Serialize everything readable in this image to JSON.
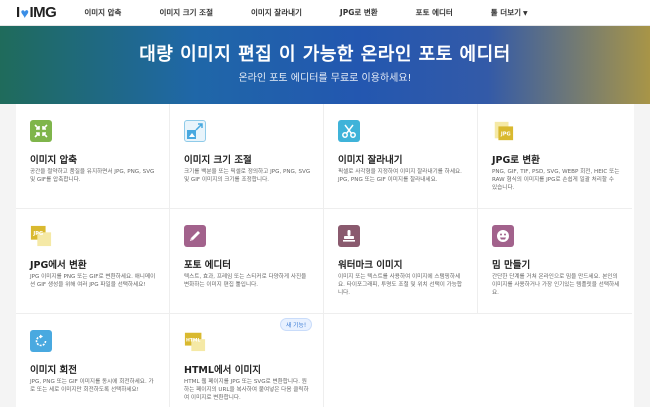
{
  "header": {
    "logo_left": "I",
    "logo_right": "IMG",
    "nav": [
      {
        "label": "이미지 압축"
      },
      {
        "label": "이미지 크기 조절"
      },
      {
        "label": "이미지 잘라내기"
      },
      {
        "label": "JPG로 변환"
      },
      {
        "label": "포토 에디터"
      },
      {
        "label": "툴 더보기"
      }
    ]
  },
  "hero": {
    "title": "대량 이미지 편집 이 가능한 온라인 포토 에디터",
    "subtitle": "온라인 포토 에디터를 무료로 이용하세요!"
  },
  "tools": [
    {
      "title": "이미지 압축",
      "desc": "공간을 절약하고 품질을 유지하면서 JPG, PNG, SVG 및 GIF를 압축합니다.",
      "icon": "compress-arrows-icon",
      "color": "#7fb54b"
    },
    {
      "title": "이미지 크기 조절",
      "desc": "크기를 백분율 또는 픽셀로 정의하고 JPG, PNG, SVG 및 GIF 이미지의 크기를 조정합니다.",
      "icon": "resize-image-icon",
      "color": "#49a9e0"
    },
    {
      "title": "이미지 잘라내기",
      "desc": "픽셀로 사각형을 지정하여 이미지 잘라내기를 하세요. JPG, PNG 또는 GIF 이미지를 잘라내세요.",
      "icon": "scissors-icon",
      "color": "#3fb3d9"
    },
    {
      "title": "JPG로 변환",
      "desc": "PNG, GIF, TIF, PSD, SVG, WEBP 회전, HEIC 또는 RAW 형식의 이미지를 JPG로 손쉽게 일괄 처리할 수 있습니다.",
      "icon": "jpg-file-icon",
      "color": "#d9b92f",
      "badge_text": "JPG"
    },
    {
      "title": "JPG에서 변환",
      "desc": "JPG 이미지를 PNG 또는 GIF로 변환하세요. 애니메이션 GIF 생성을 위해 여러 JPG 파일을 선택하세요!",
      "icon": "jpg-convert-icon",
      "color": "#d9b92f",
      "badge_text": "JPG"
    },
    {
      "title": "포토 에디터",
      "desc": "텍스트, 효과, 프레임 또는 스티커로 다양하게 사진을 변화하는 이미지 편집 툴입니다.",
      "icon": "pencil-icon",
      "color": "#a2628c"
    },
    {
      "title": "워터마크 이미지",
      "desc": "이미지 또는 텍스트를 사용하여 이미지에 스탬핑하세요. 타이포그래피, 투명도 조절 및 위치 선택이 가능합니다.",
      "icon": "stamp-icon",
      "color": "#8a5a6e"
    },
    {
      "title": "밈 만들기",
      "desc": "간단한 단계를 거쳐 온라인으로 밈을 만드세요. 본인의 이미지를 사용하거나 가장 인기있는 템플릿을 선택하세요.",
      "icon": "meme-face-icon",
      "color": "#a2628c"
    },
    {
      "title": "이미지 회전",
      "desc": "JPG, PNG 또는 GIF 이미지를 동시에 회전하세요. 가로 또는 세로 이미지만 회전하도록 선택하세요!",
      "icon": "rotate-icon",
      "color": "#49a9e0"
    },
    {
      "title": "HTML에서 이미지",
      "desc": "HTML 웹 페이지를 JPG 또는 SVG로 변환합니다. 원하는 페이지의 URL을 복사하여 붙여넣은 다음 클릭하여 이미지로 변환합니다.",
      "icon": "html-file-icon",
      "color": "#d9b92f",
      "badge_text": "HTML",
      "new_label": "새 기능!"
    }
  ]
}
